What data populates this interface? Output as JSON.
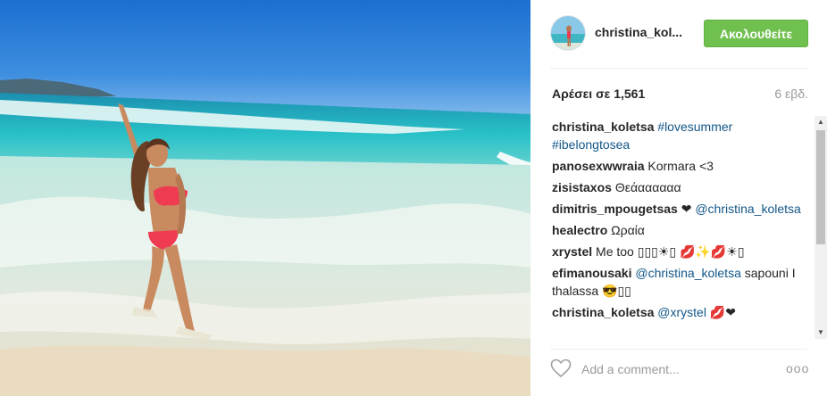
{
  "colors": {
    "follow_bg": "#70c050",
    "link": "#125688",
    "text": "#262626",
    "muted": "#999999"
  },
  "post": {
    "username": "christina_kol...",
    "follow_label": "Ακολουθείτε",
    "likes": "Αρέσει σε 1,561",
    "timestamp": "6 εβδ.",
    "comment_placeholder": "Add a comment...",
    "more_label": "ooo"
  },
  "comments": [
    {
      "author": "christina_koletsa",
      "parts": [
        {
          "type": "hashtag",
          "text": "#lovesummer"
        },
        {
          "type": "hashtag",
          "text": "#ibelongtosea"
        }
      ]
    },
    {
      "author": "panosexwwraia",
      "parts": [
        {
          "type": "text",
          "text": "Kormara <3"
        }
      ]
    },
    {
      "author": "zisistaxos",
      "parts": [
        {
          "type": "text",
          "text": "Θεάαααααα"
        }
      ]
    },
    {
      "author": "dimitris_mpougetsas",
      "parts": [
        {
          "type": "text",
          "text": "❤"
        },
        {
          "type": "mention",
          "text": "@christina_koletsa"
        }
      ]
    },
    {
      "author": "healectro",
      "parts": [
        {
          "type": "text",
          "text": "Ωραία"
        }
      ]
    },
    {
      "author": "xrystel",
      "parts": [
        {
          "type": "text",
          "text": "Me too ▯▯▯☀▯ 💋✨💋☀▯"
        }
      ]
    },
    {
      "author": "efimanousaki",
      "parts": [
        {
          "type": "mention",
          "text": "@christina_koletsa"
        },
        {
          "type": "text",
          "text": "sapouni I thalassa 😎▯▯"
        }
      ]
    },
    {
      "author": "christina_koletsa",
      "parts": [
        {
          "type": "mention",
          "text": "@xrystel"
        },
        {
          "type": "text",
          "text": "💋❤"
        }
      ]
    }
  ]
}
